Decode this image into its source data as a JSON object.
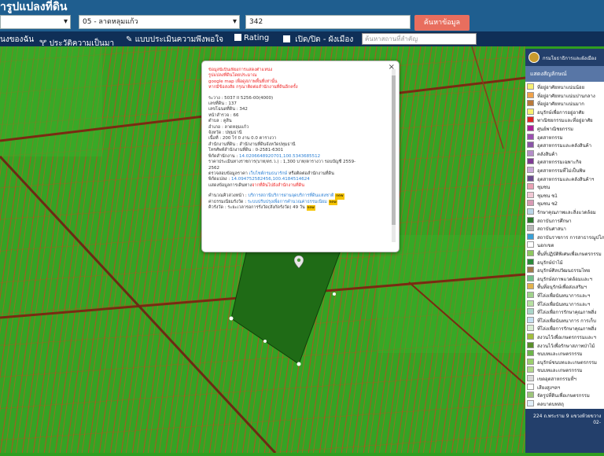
{
  "header": {
    "title": "ารูปแปลงที่ดิน",
    "province_select": "",
    "district_select": "05 - ลาดหลุมแก้ว",
    "parcel_input": "342",
    "search_button": "ค้นหาข้อมูล"
  },
  "toolbar": {
    "item_1": "นงของฉัน",
    "item_2": "ประวัติความเป็นมา",
    "item_3": "แบบประเมินความพึงพอใจ",
    "item_4": "Rating",
    "item_5": "เปิด/ปิด - ผังเมือง",
    "place_search_placeholder": "ค้นหาสถานที่สำคัญ"
  },
  "popup": {
    "warning_1": "ข้อมูลนี้เป็นเพียงการแสดงตำแหน่ง",
    "warning_2": "รูปแปลงที่ดินโดยประมาณ",
    "warning_3": "google map เพื่อดูสภาพพื้นที่เท่านั้น",
    "warning_4": "หากมีข้อสงสัย กรุณาติดต่อสำนักงานที่ดินอีกครั้ง",
    "survey_sheet": "ระวาง : 5037 II 5256-00(4000)",
    "land_no": "เลขที่ดิน : 137",
    "deed_no": "เลขโฉนดที่ดิน : 342",
    "survey_page": "หน้าสำรวจ : 66",
    "tambon": "ตำบล : คูสิน",
    "amphoe": "อำเภอ : ลาดหลุมแก้ว",
    "province": "จังหวัด : ปทุมธานี",
    "area": "เนื้อที่ : 200 ไร่ 0 งาน 0.0 ตารางวา",
    "office": "สำนักงานที่ดิน : สำนักงานที่ดินจังหวัดปทุมธานี",
    "phone": "โทรศัพท์สำนักงานที่ดิน : 0-2581-6301",
    "coord_office_label": "พิกัดสำนักงาน :",
    "coord_office": "14.0206648920701,100.5343685512",
    "price_1": "ราคาประเมินทางราชการ(บาท/ตร.ว.) : 1,300 บาท/ตารางวา รอบบัญชี 2559-",
    "price_2": "2562",
    "check_prefix": "ตรวจสอบข้อมูลราคา",
    "check_link": "เว็บไซต์กรมธนารักษ์",
    "check_suffix": "หรือติดต่อสำนักงานที่ดิน",
    "coord_parcel_label": "พิกัดแปลง :",
    "coord_parcel": "14.094752582456,100.4184514624",
    "show_info_prefix": "แสดงข้อมูลการเดินทาง",
    "show_info_link": "จากที่ดินไปยังสำนักงานที่ดิน",
    "queue_label": "คำนวณคิวล่วงหน้า :",
    "queue_link": "บริการสถานีบริการผ่านจุดบริการที่ดินแห่งชาติ",
    "fee_label": "ค่าธรรมเนียมรังวัด :",
    "fee_link": "ระบบปรับปรุงเพื่อการคำนวณค่าธรรมเนียม",
    "new_tag": "new",
    "line_last": "คิวรังวัด : ระยะเวลารอการรังวัด(สังกัดรังวัด) 49 วัน"
  },
  "legend": {
    "header": "กรมโยธาธิการและผังเมือง",
    "subtitle": "แสดงสัญลักษณ์",
    "items": [
      {
        "label": "ที่อยู่อาศัยหนาแน่นน้อย",
        "color": "#f6ef74"
      },
      {
        "label": "ที่อยู่อาศัยหนาแน่นปานกลาง",
        "color": "#f0a24a"
      },
      {
        "label": "ที่อยู่อาศัยหนาแน่นมาก",
        "color": "#b97a3b"
      },
      {
        "label": "อนุรักษ์เพื่อการอยู่อาศัย",
        "color": "#f8f070"
      },
      {
        "label": "พาณิชยกรรมและที่อยู่อาศัย",
        "color": "#e02424"
      },
      {
        "label": "ศูนย์พาณิชยกรรม",
        "color": "#b0209a"
      },
      {
        "label": "อุตสาหกรรม",
        "color": "#9b4fb0"
      },
      {
        "label": "อุตสาหกรรมและคลังสินค้า",
        "color": "#8a55a8"
      },
      {
        "label": "คลังสินค้า",
        "color": "#b48ec9"
      },
      {
        "label": "อุตสาหกรรมเฉพาะกิจ",
        "color": "#7e3a94"
      },
      {
        "label": "อุตสาหกรรมที่ไม่เป็นพิษ",
        "color": "#c9a8d8"
      },
      {
        "label": "อุตสาหกรรมและคลังสินค้าฯ",
        "color": "#6b4c8f"
      },
      {
        "label": "ชุมชน",
        "color": "#e9a1b4"
      },
      {
        "label": "ชุมชน ช1",
        "color": "#f1c8d4"
      },
      {
        "label": "ชุมชน ช2",
        "color": "#d89ab4"
      },
      {
        "label": "รักษาคุณภาพและสิ่งแวดล้อม",
        "color": "#b9d6e8"
      },
      {
        "label": "สถาบันการศึกษา",
        "color": "#2f7a2f"
      },
      {
        "label": "สถาบันศาสนา",
        "color": "#b5b5b5"
      },
      {
        "label": "สถาบันราชการ การสาธารณูปโภค",
        "color": "#3aa0d6"
      },
      {
        "label": "นอกเขต",
        "color": "#ffffff"
      },
      {
        "label": "พื้นที่ปฏิบัติพิเศษเพื่อเกษตรกรรม",
        "color": "#8fc760"
      },
      {
        "label": "อนุรักษ์ป่าไม้",
        "color": "#2b8a3a"
      },
      {
        "label": "อนุรักษ์ศิลปวัฒนธรรมไทย",
        "color": "#a07a4a"
      },
      {
        "label": "อนุรักษ์สภาพแวดล้อมและฯ",
        "color": "#72c08a"
      },
      {
        "label": "พื้นที่อนุรักษ์เพื่อส่งเสริมฯ",
        "color": "#e1b14d"
      },
      {
        "label": "ที่โล่งเพื่อนันทนาการและฯ",
        "color": "#9fd28a"
      },
      {
        "label": "ที่โล่งเพื่อนันทนาการและฯ",
        "color": "#b7e0a2"
      },
      {
        "label": "ที่โล่งเพื่อการรักษาคุณภาพสิ่ง",
        "color": "#a9d6c9"
      },
      {
        "label": "ที่โล่งเพื่อนันทนาการ การเก็บ",
        "color": "#c3dff0"
      },
      {
        "label": "ที่โล่งเพื่อการรักษาคุณภาพสิ่ง",
        "color": "#d7ecd0"
      },
      {
        "label": "สงวนไว้เพื่อเกษตรกรรมและฯ",
        "color": "#a2bd3d"
      },
      {
        "label": "สงวนไว้เพื่อรักษาสภาพป่าไม้",
        "color": "#5a8f2a"
      },
      {
        "label": "ชนบทและเกษตรกรรม",
        "color": "#6db54a"
      },
      {
        "label": "อนุรักษ์ชนบทและเกษตรกรรม",
        "color": "#9bd06c"
      },
      {
        "label": "ชนบทและเกษตรกรรม",
        "color": "#b3d98a"
      },
      {
        "label": "เขตอุตสาหกรรมที่ฯ",
        "color": "#d9d9d9"
      },
      {
        "label": "เสียงสูงฯลฯ",
        "color": "#ffffff"
      },
      {
        "label": "จัดรูปที่ดินเพื่อเกษตรกรรม",
        "color": "#9cc57a"
      },
      {
        "label": "คลบาดบทสถุ",
        "color": "#e0eef8"
      }
    ],
    "footer_1": "224 ถ.พระราม 9 แขวงห้วยขวาง",
    "footer_2": "02-"
  }
}
